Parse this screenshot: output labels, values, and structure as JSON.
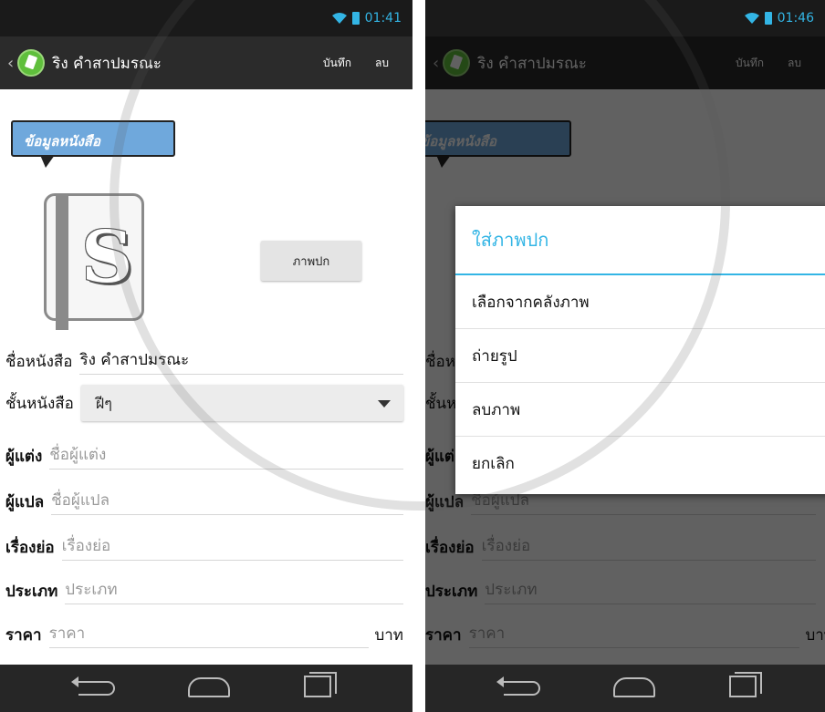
{
  "left": {
    "status": {
      "time": "01:41"
    },
    "action_bar": {
      "back": "‹",
      "title": "ริง คำสาปมรณะ",
      "save_label": "บันทึก",
      "delete_label": "ลบ"
    },
    "section_label": "ข้อมูลหนังสือ",
    "cover_letter": "S",
    "cover_button_label": "ภาพปก",
    "fields": {
      "title": {
        "label": "ชื่อหนังสือ",
        "value": "ริง คำสาปมรณะ"
      },
      "shelf": {
        "label": "ชั้นหนังสือ",
        "value": "ฝีๆ"
      },
      "author": {
        "label": "ผู้แต่ง",
        "placeholder": "ชื่อผู้แต่ง"
      },
      "translator": {
        "label": "ผู้แปล",
        "placeholder": "ชื่อผู้แปล"
      },
      "synopsis": {
        "label": "เรื่องย่อ",
        "placeholder": "เรื่องย่อ"
      },
      "genre": {
        "label": "ประเภท",
        "placeholder": "ประเภท"
      },
      "price": {
        "label": "ราคา",
        "placeholder": "ราคา",
        "unit": "บาท"
      }
    }
  },
  "right": {
    "status": {
      "time": "01:46"
    },
    "dialog": {
      "title": "ใส่ภาพปก",
      "items": [
        "เลือกจากคลังภาพ",
        "ถ่ายรูป",
        "ลบภาพ",
        "ยกเลิก"
      ]
    }
  },
  "colors": {
    "accent": "#33b5e5",
    "actionbar": "#2b2b2b",
    "navbar": "#262626",
    "tag": "#6fa8dc"
  }
}
